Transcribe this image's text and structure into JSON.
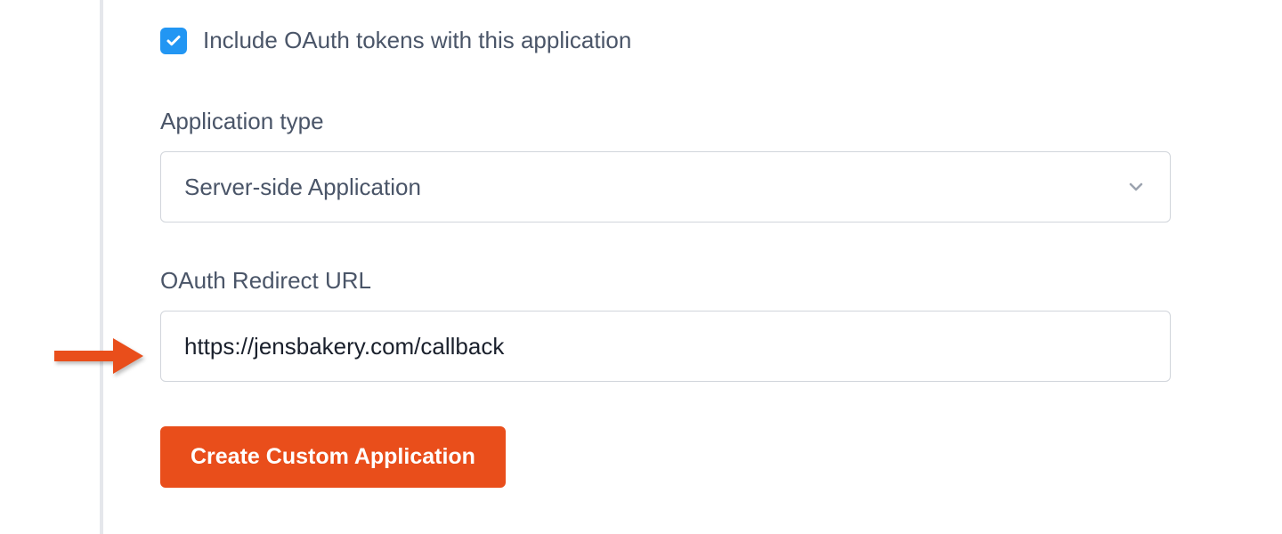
{
  "oauth_checkbox": {
    "checked": true,
    "label": "Include OAuth tokens with this application"
  },
  "app_type": {
    "label": "Application type",
    "selected": "Server-side Application"
  },
  "redirect_url": {
    "label": "OAuth Redirect URL",
    "value": "https://jensbakery.com/callback"
  },
  "submit_button": {
    "label": "Create Custom Application"
  },
  "colors": {
    "accent": "#2296f3",
    "primary_action": "#e94e1b"
  }
}
